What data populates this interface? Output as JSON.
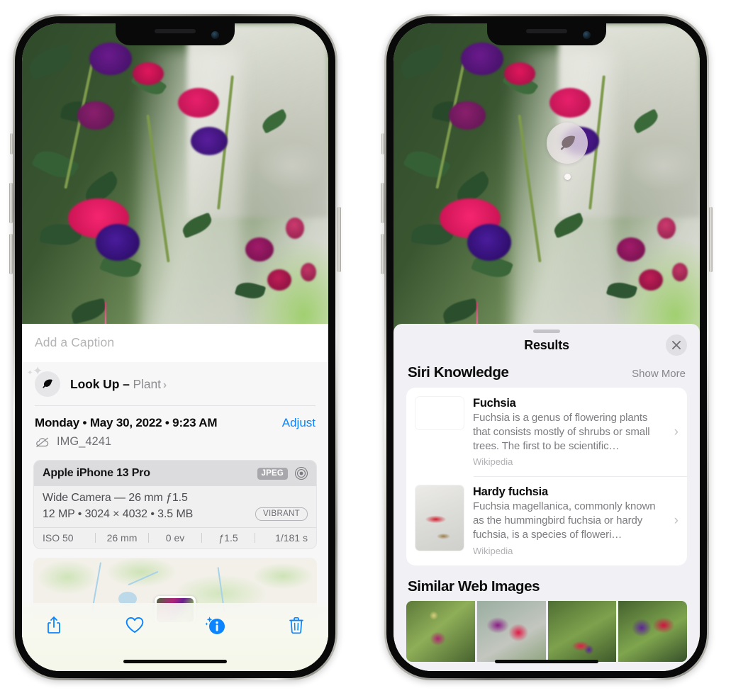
{
  "left_phone": {
    "photo": {
      "name": "fuchsia-flowers-photo"
    },
    "caption_placeholder": "Add a Caption",
    "lookup": {
      "icon": "leaf-icon",
      "label": "Look Up",
      "dash": "–",
      "subject": "Plant",
      "chevron": "›"
    },
    "meta": {
      "date": "Monday • May 30, 2022 • 9:23 AM",
      "adjust_label": "Adjust",
      "cloud_icon": "cloud-slash-icon",
      "filename": "IMG_4241"
    },
    "camera": {
      "model": "Apple iPhone 13 Pro",
      "format_badge": "JPEG",
      "lens_icon": "aperture-icon",
      "lens_line": "Wide Camera — 26 mm ƒ1.5",
      "size_line": "12 MP • 3024 × 4032 • 3.5 MB",
      "style_badge": "VIBRANT",
      "exif": [
        "ISO 50",
        "26 mm",
        "0 ev",
        "ƒ1.5",
        "1/181 s"
      ]
    },
    "map": {
      "name": "location-map-thumbnail"
    },
    "toolbar": [
      {
        "name": "share-button",
        "icon": "share-icon"
      },
      {
        "name": "favorite-button",
        "icon": "heart-icon"
      },
      {
        "name": "info-button",
        "icon": "info-sparkle-icon"
      },
      {
        "name": "delete-button",
        "icon": "trash-icon"
      }
    ],
    "accent_color": "#0a84ff"
  },
  "right_phone": {
    "visual_lookup_badge": {
      "icon": "leaf-icon"
    },
    "sheet": {
      "title": "Results",
      "close_icon": "close-icon",
      "siri_knowledge": {
        "heading": "Siri Knowledge",
        "action": "Show More",
        "items": [
          {
            "title": "Fuchsia",
            "description": "Fuchsia is a genus of flowering plants that consists mostly of shrubs or small trees. The first to be scientific…",
            "source": "Wikipedia",
            "chevron": "›"
          },
          {
            "title": "Hardy fuchsia",
            "description": "Fuchsia magellanica, commonly known as the hummingbird fuchsia or hardy fuchsia, is a species of floweri…",
            "source": "Wikipedia",
            "chevron": "›"
          }
        ]
      },
      "similar_web_images": {
        "heading": "Similar Web Images",
        "thumbnails": [
          {
            "name": "web-image-1"
          },
          {
            "name": "web-image-2"
          },
          {
            "name": "web-image-3"
          },
          {
            "name": "web-image-4"
          }
        ]
      }
    }
  }
}
